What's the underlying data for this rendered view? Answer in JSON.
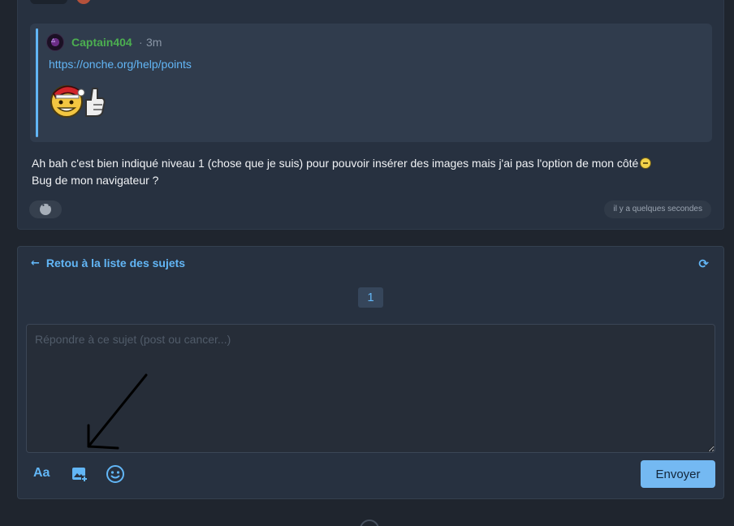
{
  "post": {
    "quote": {
      "author": "Captain404",
      "separator": "·",
      "time": "3m",
      "link": "https://onche.org/help/points"
    },
    "text_line1": "Ah bah c'est bien indiqué niveau 1 (chose que je suis) pour pouvoir insérer des images mais j'ai pas l'option de mon côté",
    "text_line2": "Bug de mon navigateur ?",
    "timestamp": "il y a quelques secondes"
  },
  "reply": {
    "back_label": "Retou à la liste des sujets",
    "page_number": "1",
    "placeholder": "Répondre à ce sujet (post ou cancer...)",
    "font_tool_label": "Aa",
    "send_label": "Envoyer"
  },
  "colors": {
    "accent": "#62b6f6",
    "author_green": "#4caf50",
    "send_button": "#74b9f2",
    "background": "#1f252e",
    "card": "#273140"
  },
  "icons": [
    "star-badge-icon",
    "arrow-left-icon",
    "refresh-icon",
    "image-add-icon",
    "emoji-icon",
    "reaction-icon"
  ]
}
